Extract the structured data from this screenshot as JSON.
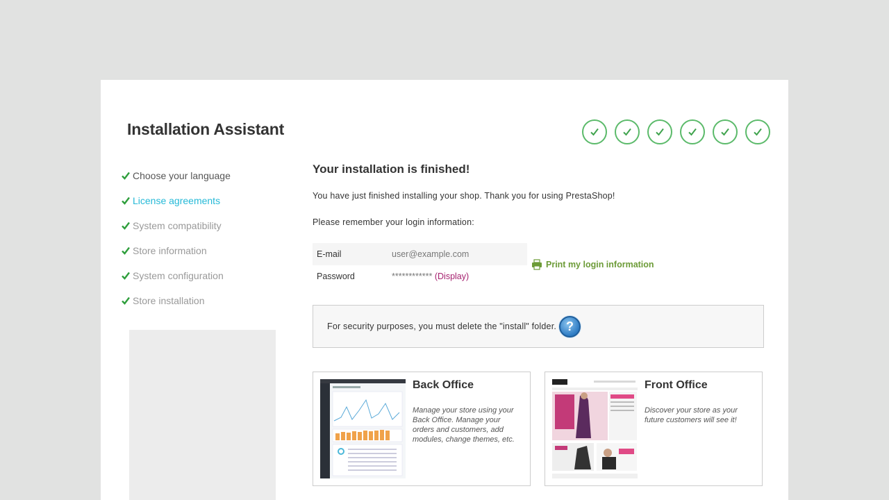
{
  "app": {
    "title": "Installation Assistant"
  },
  "progress": {
    "steps_completed": 6,
    "steps_total": 6,
    "check_color": "#5bba6a"
  },
  "sidebar": {
    "items": [
      {
        "label": "Choose your language",
        "state": "current"
      },
      {
        "label": "License agreements",
        "state": "link"
      },
      {
        "label": "System compatibility",
        "state": "done"
      },
      {
        "label": "Store information",
        "state": "done"
      },
      {
        "label": "System configuration",
        "state": "done"
      },
      {
        "label": "Store installation",
        "state": "done"
      }
    ]
  },
  "main": {
    "heading": "Your installation is finished!",
    "intro": "You have just finished installing your shop. Thank you for using PrestaShop!",
    "remember": "Please remember your login information:",
    "login": {
      "email_label": "E-mail",
      "email_value": "user@example.com",
      "password_label": "Password",
      "password_value": "************",
      "display_link": "(Display)"
    },
    "print_link": "Print my login information",
    "security_notice": "For security purposes, you must delete the \"install\" folder.",
    "help_icon_label": "?"
  },
  "cards": {
    "back_office": {
      "title": "Back Office",
      "description": "Manage your store using your Back Office. Manage your orders and customers, add modules, change themes, etc."
    },
    "front_office": {
      "title": "Front Office",
      "description": "Discover your store as your future customers will see it!"
    }
  },
  "colors": {
    "accent_green": "#5bba6a",
    "link_blue": "#25b9d7",
    "print_green": "#6c9b37",
    "display_magenta": "#a6216f"
  }
}
